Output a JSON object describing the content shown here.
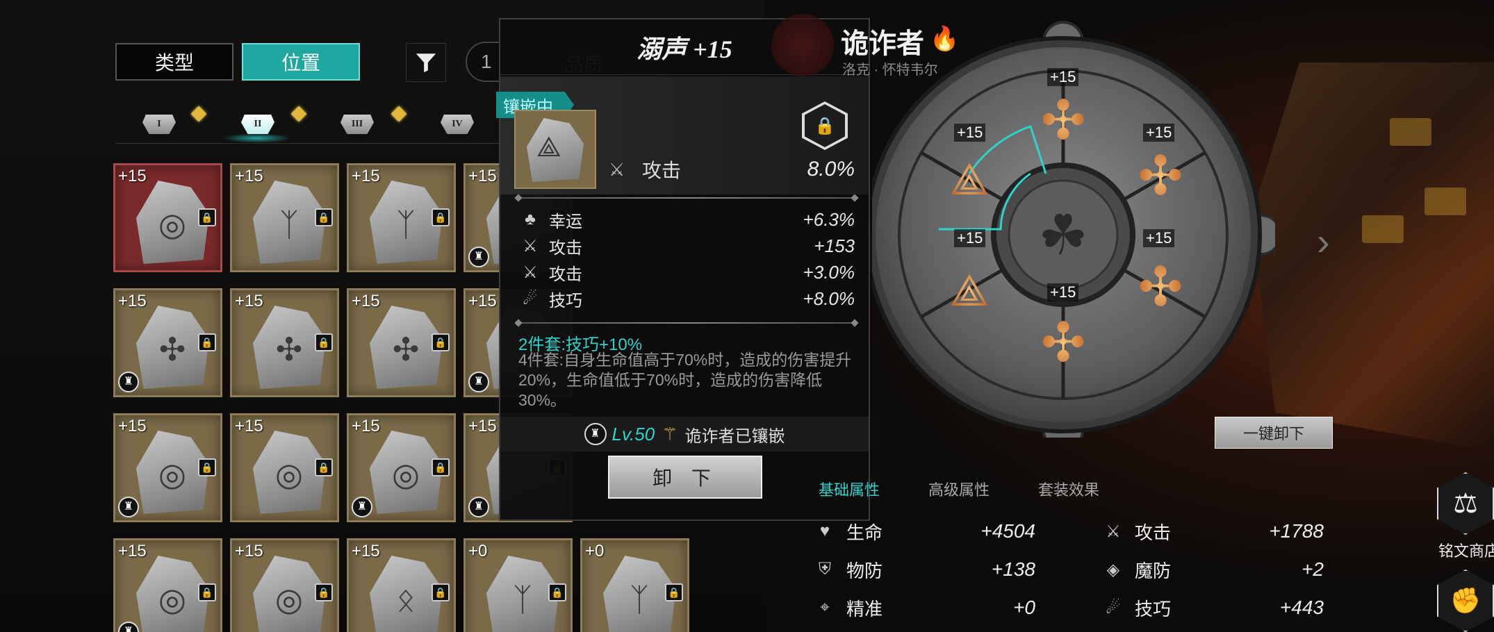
{
  "filters": {
    "type_label": "类型",
    "position_label": "位置",
    "quality_label": "品质",
    "quality_prefix": "1"
  },
  "slots": [
    "I",
    "II",
    "III",
    "IV"
  ],
  "grid": [
    [
      {
        "lvl": "+15",
        "glyph": "◎",
        "helm": false,
        "selected": true
      },
      {
        "lvl": "+15",
        "glyph": "ᛉ",
        "helm": false
      },
      {
        "lvl": "+15",
        "glyph": "ᛉ",
        "helm": false
      },
      {
        "lvl": "+15",
        "glyph": "",
        "helm": true
      }
    ],
    [
      {
        "lvl": "+15",
        "glyph": "✣",
        "helm": true
      },
      {
        "lvl": "+15",
        "glyph": "✣",
        "helm": false
      },
      {
        "lvl": "+15",
        "glyph": "✣",
        "helm": false
      },
      {
        "lvl": "+15",
        "glyph": "",
        "helm": true
      }
    ],
    [
      {
        "lvl": "+15",
        "glyph": "◎",
        "helm": true
      },
      {
        "lvl": "+15",
        "glyph": "◎",
        "helm": false
      },
      {
        "lvl": "+15",
        "glyph": "◎",
        "helm": true
      },
      {
        "lvl": "+15",
        "glyph": "",
        "helm": true
      }
    ],
    [
      {
        "lvl": "+15",
        "glyph": "◎",
        "helm": true
      },
      {
        "lvl": "+15",
        "glyph": "◎",
        "helm": false
      },
      {
        "lvl": "+15",
        "glyph": "ᛟ",
        "helm": false
      },
      {
        "lvl": "+0",
        "glyph": "ᛉ",
        "helm": false
      },
      {
        "lvl": "+0",
        "glyph": "ᛉ",
        "helm": false
      }
    ]
  ],
  "tooltip": {
    "title": "溺声 +15",
    "badge": "镶嵌中",
    "main_stat": {
      "label": "攻击",
      "value": "8.0%",
      "icon": "crossed-swords-icon"
    },
    "sub_stats": [
      {
        "label": "幸运",
        "value": "+6.3%",
        "icon": "clover-icon"
      },
      {
        "label": "攻击",
        "value": "+153",
        "icon": "crossed-swords-icon"
      },
      {
        "label": "攻击",
        "value": "+3.0%",
        "icon": "crossed-swords-icon"
      },
      {
        "label": "技巧",
        "value": "+8.0%",
        "icon": "skill-icon"
      }
    ],
    "set2": "2件套:技巧+10%",
    "set4": "4件套:自身生命值高于70%时，造成的伤害提升20%，生命值低于70%时，造成的伤害降低30%。",
    "owner_level": "Lv.50",
    "owner_text": "诡诈者已镶嵌",
    "unequip_label": "卸 下"
  },
  "character": {
    "name": "诡诈者",
    "subtitle": "洛克 · 怀特韦尔"
  },
  "wheel": {
    "labels": [
      "+15",
      "+15",
      "+15",
      "+15",
      "+15",
      "+15"
    ]
  },
  "unload_all_label": "一键卸下",
  "stat_tabs": [
    "基础属性",
    "高级属性",
    "套装效果"
  ],
  "stats": [
    {
      "label": "生命",
      "value": "+4504",
      "icon": "heart-icon"
    },
    {
      "label": "攻击",
      "value": "+1788",
      "icon": "crossed-swords-icon"
    },
    {
      "label": "物防",
      "value": "+138",
      "icon": "shield-icon"
    },
    {
      "label": "魔防",
      "value": "+2",
      "icon": "magic-shield-icon"
    },
    {
      "label": "精准",
      "value": "+0",
      "icon": "target-icon"
    },
    {
      "label": "技巧",
      "value": "+443",
      "icon": "skill-icon"
    }
  ],
  "shop_label": "铭文商店",
  "colors": {
    "accent": "#1da7a0",
    "gold": "#e0b83a",
    "selected": "#7a2a2a"
  }
}
